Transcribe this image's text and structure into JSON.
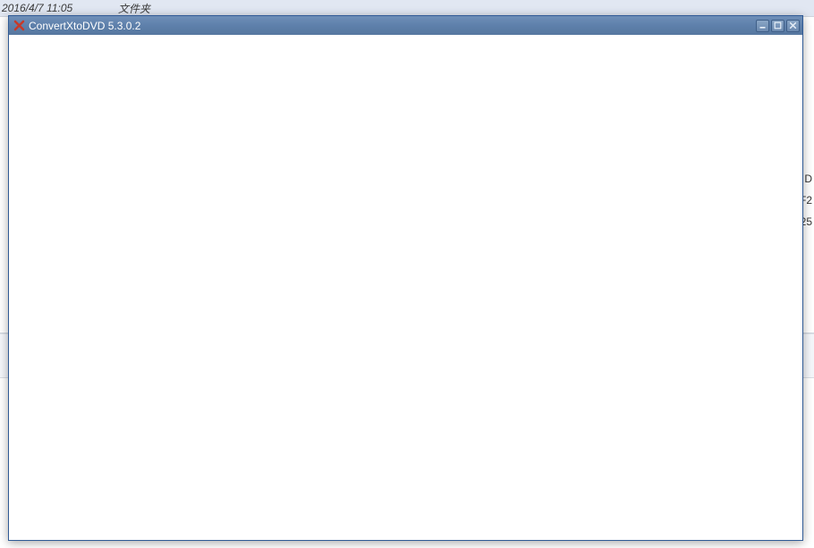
{
  "background": {
    "row": {
      "date": "2016/4/7 11:05",
      "type": "文件夹"
    },
    "right_peek": {
      "item1": "D",
      "item2": "F2",
      "item3": "25"
    }
  },
  "window": {
    "title": "ConvertXtoDVD 5.3.0.2",
    "icon_name": "app-x-icon",
    "controls": {
      "minimize": "minimize",
      "maximize": "maximize",
      "close": "close"
    }
  }
}
